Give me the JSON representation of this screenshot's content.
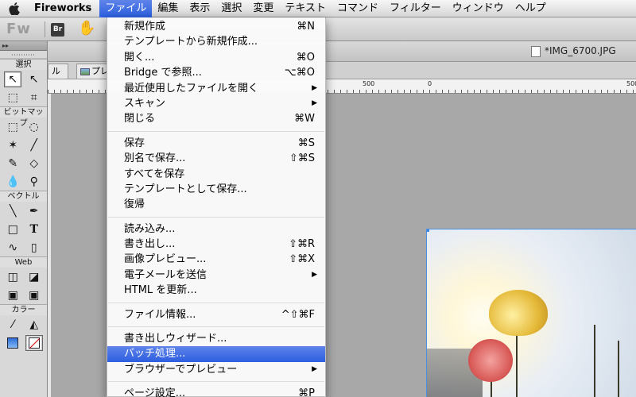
{
  "menubar": {
    "app": "Fireworks",
    "items": [
      "ファイル",
      "編集",
      "表示",
      "選択",
      "変更",
      "テキスト",
      "コマンド",
      "フィルター",
      "ウィンドウ",
      "ヘルプ"
    ]
  },
  "toolbar": {
    "app_logo": "Fw",
    "bridge_label": "Br"
  },
  "document": {
    "title": "*IMG_6700.JPG"
  },
  "mode_tabs": [
    "ル",
    "プレ"
  ],
  "ruler": {
    "labels": [
      "500",
      "0",
      "500"
    ]
  },
  "tools_panel": {
    "sections": {
      "select": "選択",
      "bitmap": "ビットマップ",
      "vector": "ベクトル",
      "web": "Web",
      "color": "カラー"
    }
  },
  "file_menu": {
    "groups": [
      [
        {
          "label": "新規作成",
          "shortcut": "⌘N"
        },
        {
          "label": "テンプレートから新規作成...",
          "shortcut": ""
        },
        {
          "label": "開く...",
          "shortcut": "⌘O"
        },
        {
          "label": "Bridge で参照...",
          "shortcut": "⌥⌘O"
        },
        {
          "label": "最近使用したファイルを開く",
          "shortcut": "",
          "submenu": true
        },
        {
          "label": "スキャン",
          "shortcut": "",
          "submenu": true
        },
        {
          "label": "閉じる",
          "shortcut": "⌘W"
        }
      ],
      [
        {
          "label": "保存",
          "shortcut": "⌘S"
        },
        {
          "label": "別名で保存...",
          "shortcut": "⇧⌘S"
        },
        {
          "label": "すべてを保存",
          "shortcut": ""
        },
        {
          "label": "テンプレートとして保存...",
          "shortcut": ""
        },
        {
          "label": "復帰",
          "shortcut": ""
        }
      ],
      [
        {
          "label": "読み込み...",
          "shortcut": ""
        },
        {
          "label": "書き出し...",
          "shortcut": "⇧⌘R"
        },
        {
          "label": "画像プレビュー...",
          "shortcut": "⇧⌘X"
        },
        {
          "label": "電子メールを送信",
          "shortcut": "",
          "submenu": true
        },
        {
          "label": "HTML を更新...",
          "shortcut": ""
        }
      ],
      [
        {
          "label": "ファイル情報...",
          "shortcut": "^⇧⌘F"
        }
      ],
      [
        {
          "label": "書き出しウィザード...",
          "shortcut": ""
        },
        {
          "label": "バッチ処理...",
          "shortcut": "",
          "highlighted": true
        },
        {
          "label": "ブラウザーでプレビュー",
          "shortcut": "",
          "submenu": true
        }
      ],
      [
        {
          "label": "ページ設定...",
          "shortcut": "⌘P"
        }
      ]
    ]
  },
  "colors": {
    "highlight": "#2c5ee0",
    "selection_border": "#4a8fe0"
  }
}
